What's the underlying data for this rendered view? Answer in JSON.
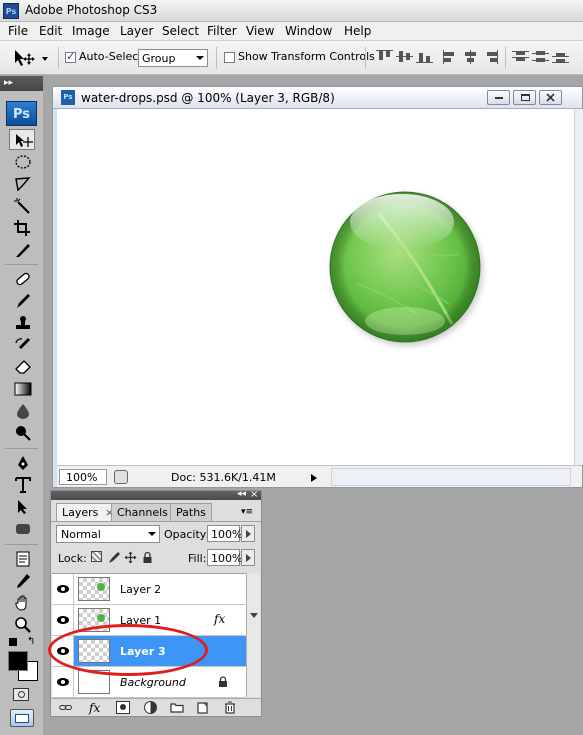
{
  "app": {
    "title": "Adobe Photoshop CS3",
    "icon_text": "Ps"
  },
  "menu": [
    "File",
    "Edit",
    "Image",
    "Layer",
    "Select",
    "Filter",
    "View",
    "Window",
    "Help"
  ],
  "options": {
    "auto_select_label": "Auto-Select:",
    "auto_select_checked": true,
    "auto_select_value": "Group",
    "show_transform_label": "Show Transform Controls",
    "show_transform_checked": false
  },
  "tools": {
    "header": "▸▸",
    "logo": "Ps",
    "items": [
      "move-tool",
      "marquee-tool",
      "lasso-tool",
      "magic-wand-tool",
      "crop-tool",
      "slice-tool",
      "healing-brush-tool",
      "brush-tool",
      "clone-stamp-tool",
      "history-brush-tool",
      "eraser-tool",
      "gradient-tool",
      "blur-tool",
      "dodge-tool",
      "pen-tool",
      "type-tool",
      "path-selection-tool",
      "shape-tool",
      "notes-tool",
      "eyedropper-tool",
      "hand-tool",
      "zoom-tool"
    ]
  },
  "document": {
    "icon_text": "Ps",
    "title": "water-drops.psd @ 100% (Layer 3, RGB/8)",
    "zoom": "100%",
    "doc_info": "Doc: 531.6K/1.41M"
  },
  "layers_panel": {
    "tabs": [
      "Layers",
      "Channels",
      "Paths"
    ],
    "active_tab": "Layers",
    "tab_close": "×",
    "blend_mode": "Normal",
    "opacity_label": "Opacity:",
    "opacity": "100%",
    "lock_label": "Lock:",
    "fill_label": "Fill:",
    "fill": "100%",
    "layers": [
      {
        "name": "Layer 2",
        "visible": true,
        "selected": false,
        "fx": false,
        "locked": false
      },
      {
        "name": "Layer 1",
        "visible": true,
        "selected": false,
        "fx": true,
        "locked": false
      },
      {
        "name": "Layer 3",
        "visible": true,
        "selected": true,
        "fx": false,
        "locked": false
      },
      {
        "name": "Background",
        "visible": true,
        "selected": false,
        "fx": false,
        "locked": true
      }
    ],
    "fx_label": "fx",
    "footer_fx": "fx"
  },
  "colors": {
    "selection": "#3d95f6",
    "highlight": "#e11d1d",
    "drop_green": "#5fbf3c"
  }
}
